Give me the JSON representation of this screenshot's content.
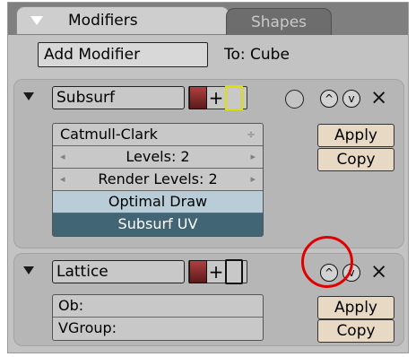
{
  "tabs": [
    {
      "label": "Modifiers",
      "active": true
    },
    {
      "label": "Shapes",
      "active": false
    }
  ],
  "add_modifier": {
    "label": "Add Modifier",
    "target": "To: Cube"
  },
  "modifiers": [
    {
      "name": "Subsurf",
      "type_select": "Catmull-Clark",
      "levels": "Levels: 2",
      "render_levels": "Render Levels: 2",
      "optimal_draw": "Optimal Draw",
      "subsurf_uv": "Subsurf UV",
      "apply_label": "Apply",
      "copy_label": "Copy"
    },
    {
      "name": "Lattice",
      "ob_field": "Ob:",
      "vgroup_field": "VGroup:",
      "apply_label": "Apply",
      "copy_label": "Copy"
    }
  ],
  "icons": {
    "close": "×",
    "up": "^",
    "down": "v",
    "stepper": "÷",
    "left": "◂",
    "right": "▸"
  },
  "colors": {
    "highlight": "#e00000",
    "toggle_active_blue": "#5a7f92",
    "toggle_dark_blue": "#3f5f6e",
    "action_button": "#e8d9c5"
  }
}
